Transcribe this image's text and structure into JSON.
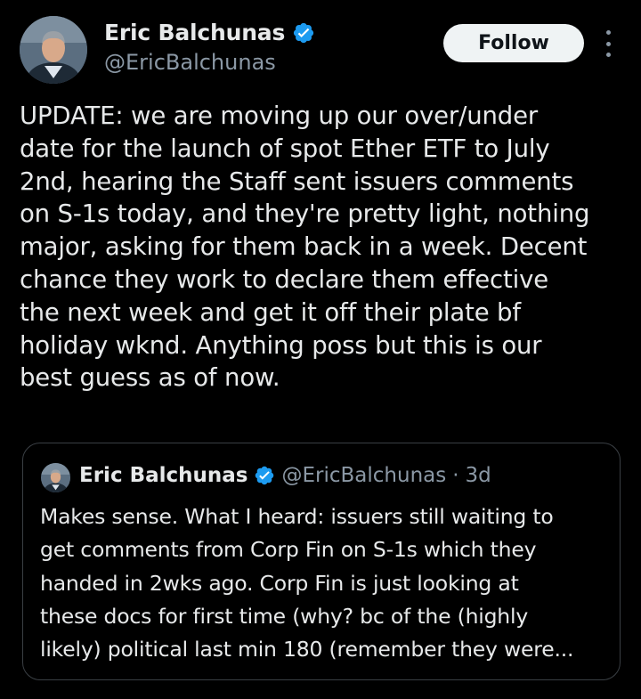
{
  "author": {
    "display_name": "Eric Balchunas",
    "handle": "@EricBalchunas",
    "verified": true
  },
  "actions": {
    "follow_label": "Follow",
    "more_icon": "more-vertical-icon"
  },
  "tweet": {
    "text": "UPDATE: we are moving up our over/under\ndate for the launch of spot Ether ETF to July\n2nd, hearing the Staff sent issuers comments\non S-1s today, and they're pretty light, nothing\nmajor, asking for them back in a week. Decent\nchance they work to declare them effective\nthe next week and get it off their plate bf\nholiday wknd. Anything poss but this is our\nbest guess as of now."
  },
  "quoted_tweet": {
    "display_name": "Eric Balchunas",
    "handle": "@EricBalchunas",
    "separator": "·",
    "time": "3d",
    "text": "Makes sense. What I heard: issuers still waiting to\nget comments from Corp Fin on S-1s which they\nhanded in 2wks ago. Corp Fin is just looking at\nthese docs for first time (why? bc of the (highly\nlikely) political last min 180 (remember they were..."
  },
  "colors": {
    "background": "#000000",
    "text_primary": "#e7e9ea",
    "text_secondary": "#8b98a5",
    "verified_blue": "#1d9bf0",
    "follow_bg": "#eff3f4",
    "border": "#3a3f44"
  }
}
